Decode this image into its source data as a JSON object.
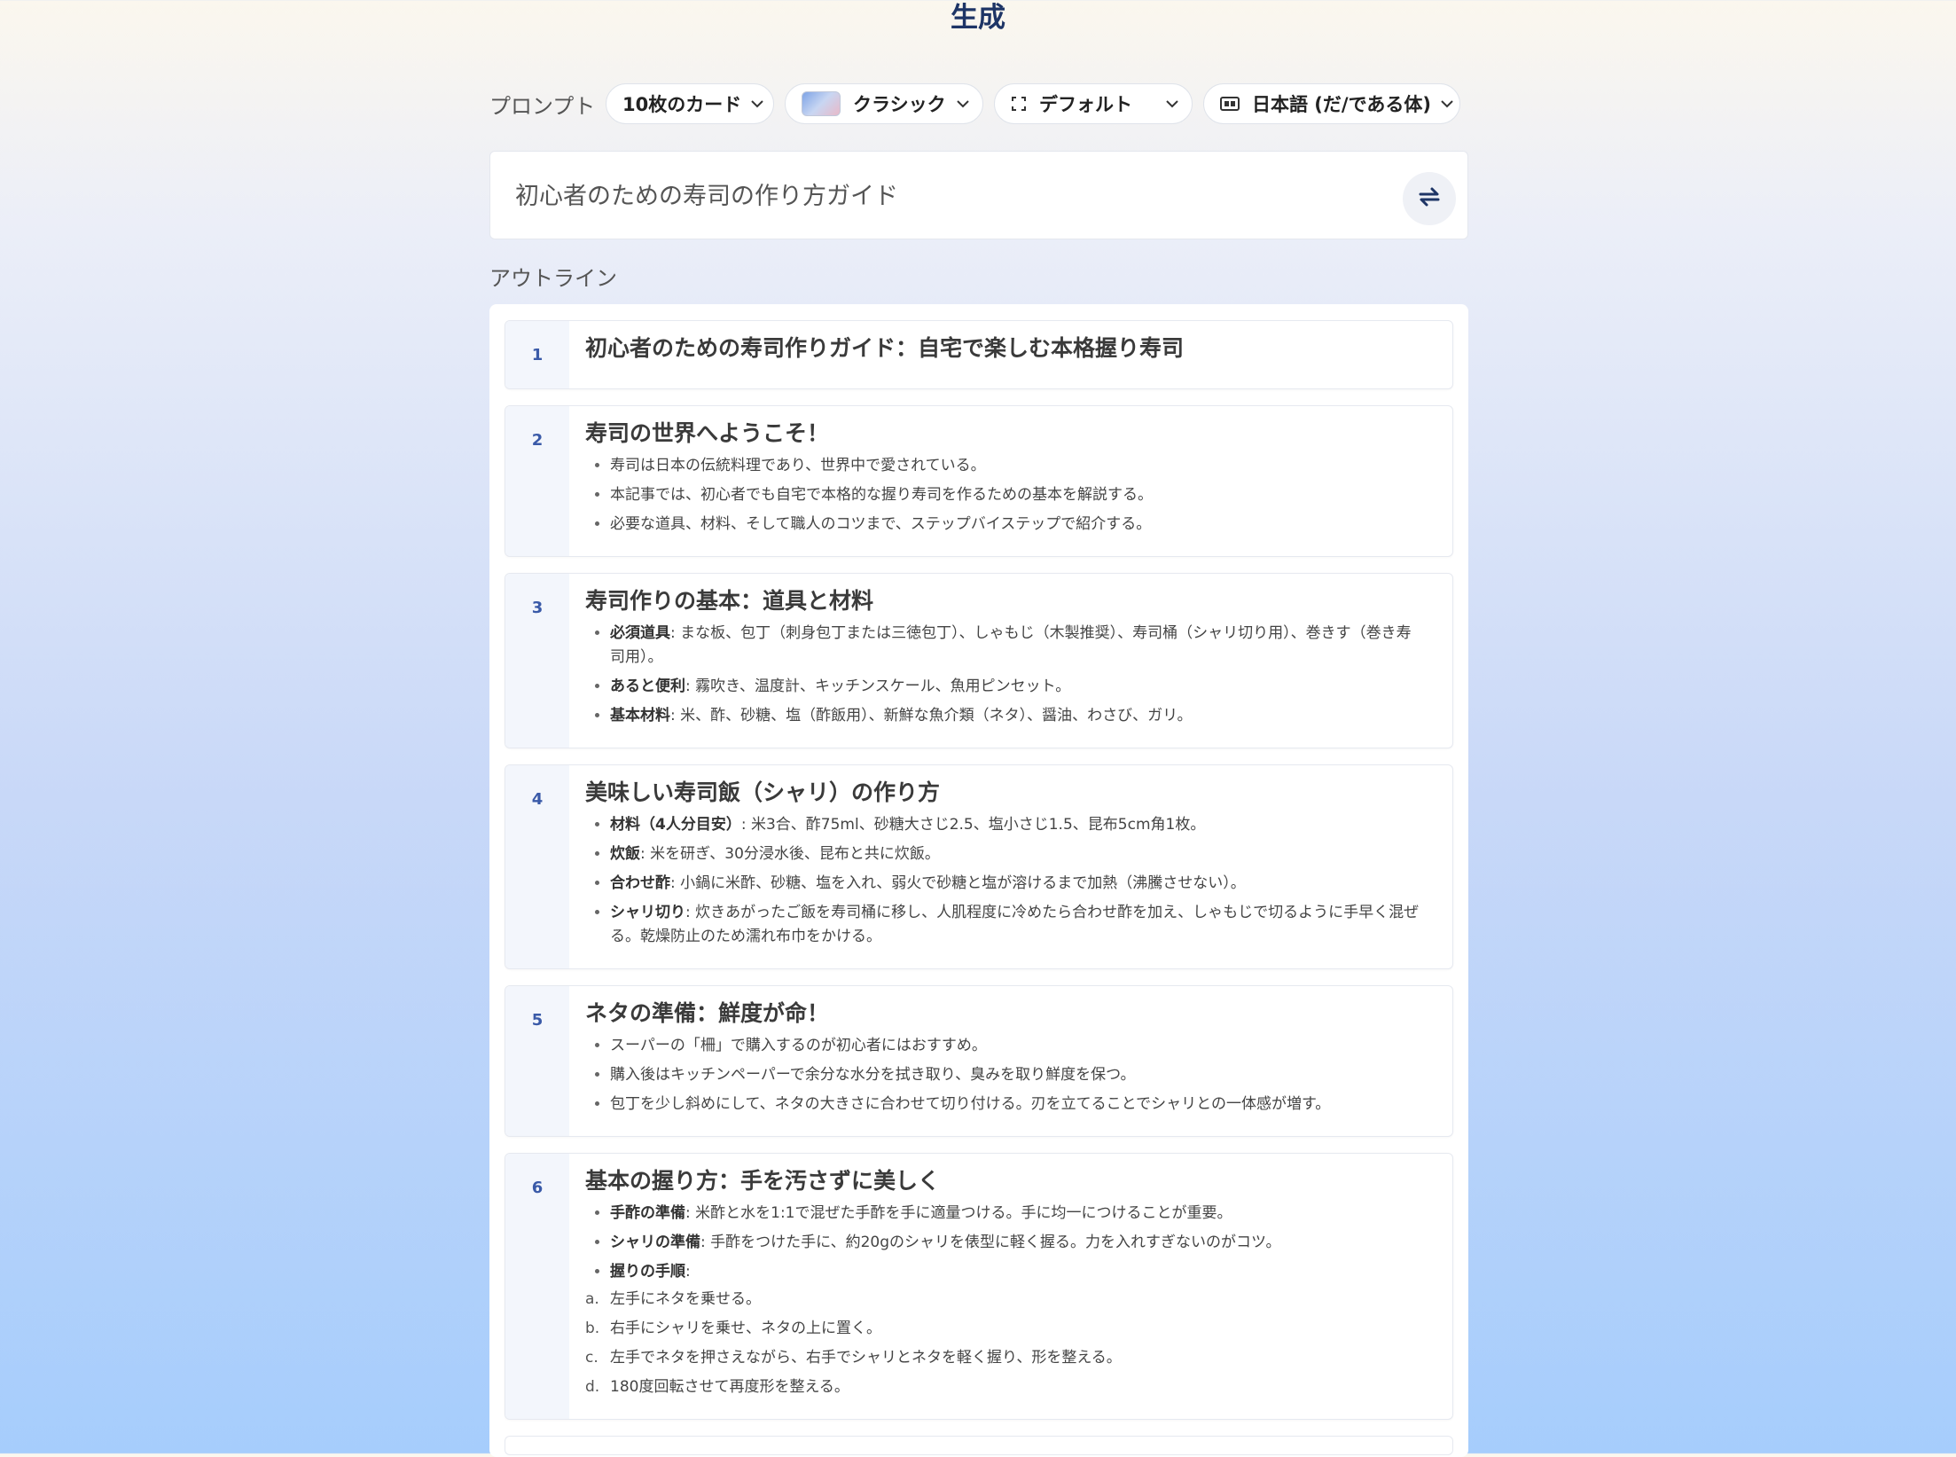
{
  "page": {
    "title": "生成"
  },
  "toolbar": {
    "prompt_label": "プロンプト",
    "cards": "10枚のカード",
    "theme": "クラシック",
    "format": "デフォルト",
    "language": "日本語 (だ/である体)"
  },
  "prompt": {
    "text": "初心者のための寿司の作り方ガイド"
  },
  "outline": {
    "label": "アウトライン",
    "cards": [
      {
        "num": "1",
        "title": "初心者のための寿司作りガイド：自宅で楽しむ本格握り寿司"
      },
      {
        "num": "2",
        "title": "寿司の世界へようこそ！",
        "b0": "寿司は日本の伝統料理であり、世界中で愛されている。",
        "b1": "本記事では、初心者でも自宅で本格的な握り寿司を作るための基本を解説する。",
        "b2": "必要な道具、材料、そして職人のコツまで、ステップバイステップで紹介する。"
      },
      {
        "num": "3",
        "title": "寿司作りの基本：道具と材料",
        "k0": "必須道具",
        "b0": ": まな板、包丁（刺身包丁または三徳包丁）、しゃもじ（木製推奨）、寿司桶（シャリ切り用）、巻きす（巻き寿司用）。",
        "k1": "あると便利",
        "b1": ": 霧吹き、温度計、キッチンスケール、魚用ピンセット。",
        "k2": "基本材料",
        "b2": ": 米、酢、砂糖、塩（酢飯用）、新鮮な魚介類（ネタ）、醤油、わさび、ガリ。"
      },
      {
        "num": "4",
        "title": "美味しい寿司飯（シャリ）の作り方",
        "k0": "材料（4人分目安）",
        "b0": ": 米3合、酢75ml、砂糖大さじ2.5、塩小さじ1.5、昆布5cm角1枚。",
        "k1": "炊飯",
        "b1": ": 米を研ぎ、30分浸水後、昆布と共に炊飯。",
        "k2": "合わせ酢",
        "b2": ": 小鍋に米酢、砂糖、塩を入れ、弱火で砂糖と塩が溶けるまで加熱（沸騰させない）。",
        "k3": "シャリ切り",
        "b3": ": 炊きあがったご飯を寿司桶に移し、人肌程度に冷めたら合わせ酢を加え、しゃもじで切るように手早く混ぜる。乾燥防止のため濡れ布巾をかける。"
      },
      {
        "num": "5",
        "title": "ネタの準備：鮮度が命！",
        "b0": "スーパーの「柵」で購入するのが初心者にはおすすめ。",
        "b1": "購入後はキッチンペーパーで余分な水分を拭き取り、臭みを取り鮮度を保つ。",
        "b2": "包丁を少し斜めにして、ネタの大きさに合わせて切り付ける。刃を立てることでシャリとの一体感が増す。"
      },
      {
        "num": "6",
        "title": "基本の握り方：手を汚さずに美しく",
        "k0": "手酢の準備",
        "b0": ": 米酢と水を1:1で混ぜた手酢を手に適量つける。手に均一につけることが重要。",
        "k1": "シャリの準備",
        "b1": ": 手酢をつけた手に、約20gのシャリを俵型に軽く握る。力を入れすぎないのがコツ。",
        "k2": "握りの手順",
        "b2": ":",
        "s0m": "a.",
        "s0": "左手にネタを乗せる。",
        "s1m": "b.",
        "s1": "右手にシャリを乗せ、ネタの上に置く。",
        "s2m": "c.",
        "s2": "左手でネタを押さえながら、右手でシャリとネタを軽く握り、形を整える。",
        "s3m": "d.",
        "s3": "180度回転させて再度形を整える。"
      }
    ]
  }
}
